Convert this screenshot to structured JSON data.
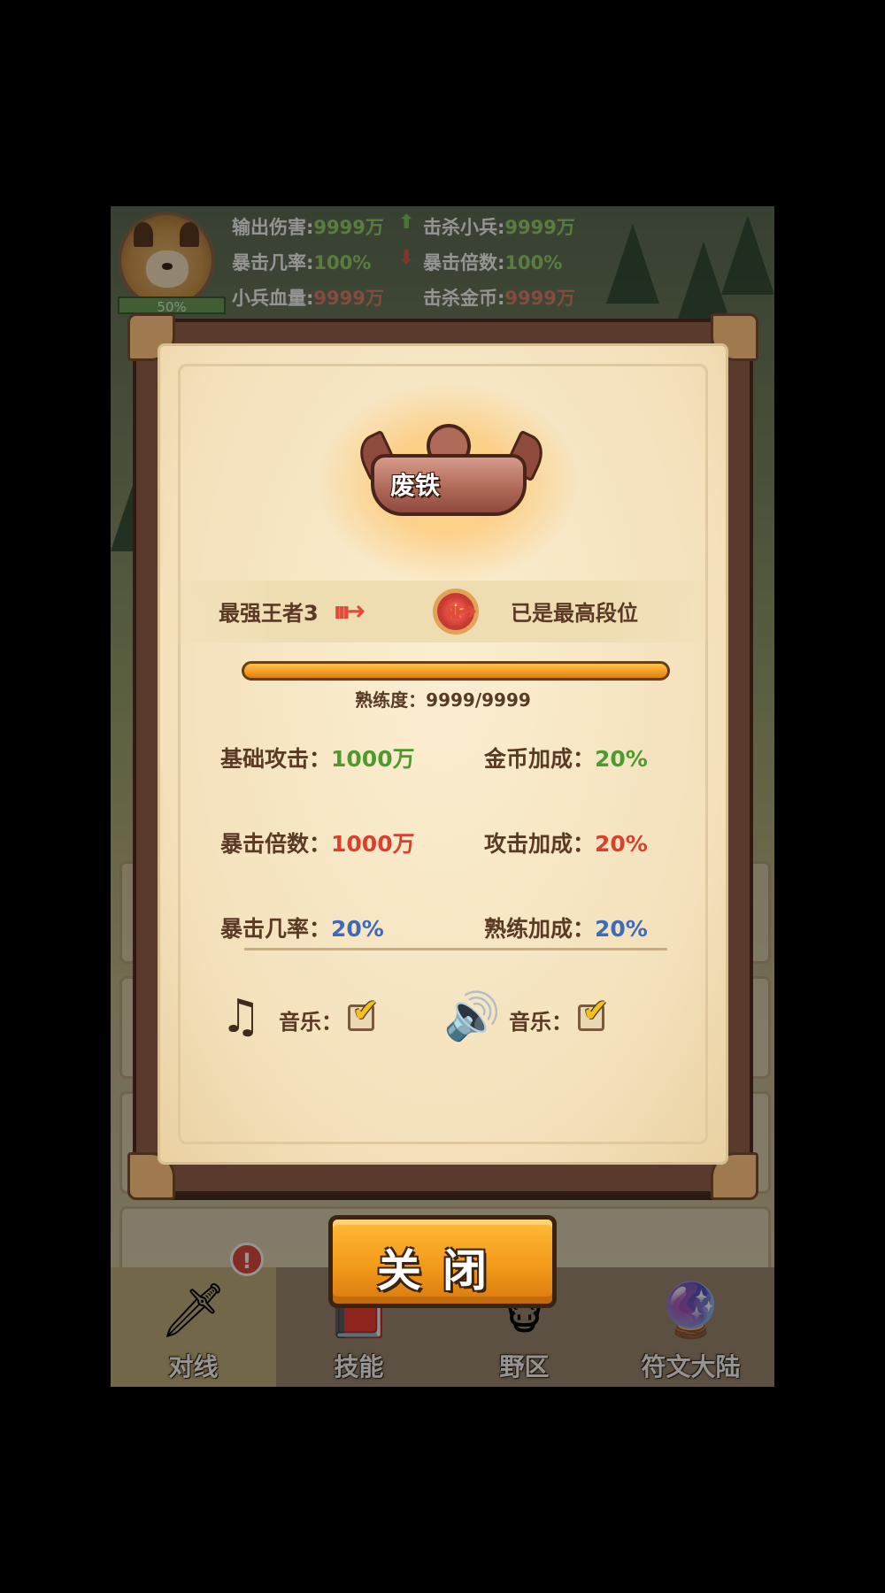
{
  "header": {
    "avatar_percent": "50%",
    "stats": [
      {
        "label": "输出伤害:",
        "value": "9999万",
        "color": "green"
      },
      {
        "label": "击杀小兵:",
        "value": "9999万",
        "color": "green"
      },
      {
        "label": "暴击几率:",
        "value": "100%",
        "color": "green"
      },
      {
        "label": "暴击倍数:",
        "value": "100%",
        "color": "green"
      },
      {
        "label": "小兵血量:",
        "value": "9999万",
        "color": "red"
      },
      {
        "label": "击杀金币:",
        "value": "9999万",
        "color": "red"
      }
    ]
  },
  "modal": {
    "rank_name": "废铁",
    "from_rank": "最强王者3",
    "to_rank": "已是最高段位",
    "proficiency_label": "熟练度：9999/9999",
    "proficiency_fraction": 1.0,
    "stats": {
      "base_attack_label": "基础攻击：",
      "base_attack_value": "1000万",
      "gold_bonus_label": "金币加成：",
      "gold_bonus_value": "20%",
      "crit_multiplier_label": "暴击倍数：",
      "crit_multiplier_value": "1000万",
      "attack_bonus_label": "攻击加成：",
      "attack_bonus_value": "20%",
      "crit_rate_label": "暴击几率：",
      "crit_rate_value": "20%",
      "proficiency_bonus_label": "熟练加成：",
      "proficiency_bonus_value": "20%"
    },
    "settings": {
      "music_label": "音乐：",
      "music_checked": true,
      "sound_label": "音乐：",
      "sound_checked": true
    },
    "close_label": "关闭"
  },
  "bottom_nav": {
    "tabs": [
      {
        "label": "对线",
        "icon": "sword-icon",
        "active": true,
        "alert": "!"
      },
      {
        "label": "技能",
        "icon": "book-icon",
        "active": false
      },
      {
        "label": "野区",
        "icon": "monster-icon",
        "active": false
      },
      {
        "label": "符文大陆",
        "icon": "crystal-icon",
        "active": false
      }
    ]
  },
  "colors": {
    "green_value": "#4f9a2f",
    "red_value": "#d9412f",
    "blue_value": "#3e6ab8",
    "button_orange": "#f39a1a"
  }
}
